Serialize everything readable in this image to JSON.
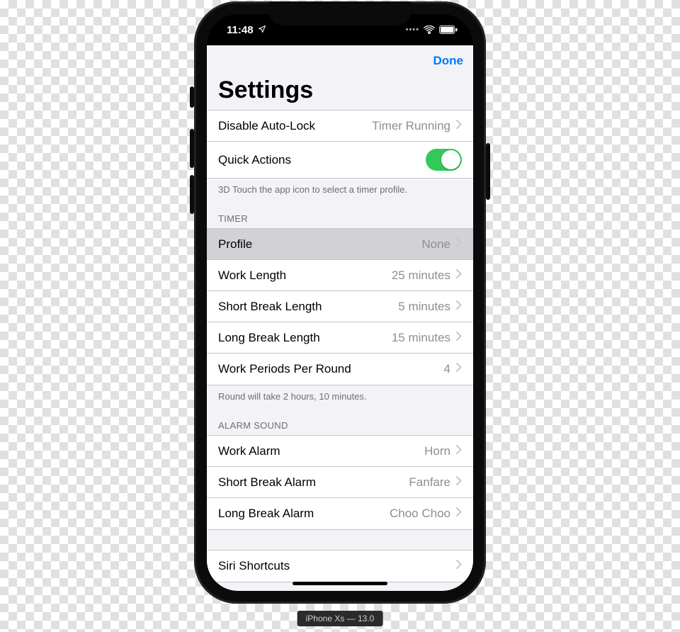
{
  "status": {
    "time": "11:48",
    "location_arrow": "➤"
  },
  "navbar": {
    "done": "Done"
  },
  "title": "Settings",
  "group1": {
    "items": [
      {
        "label": "Disable Auto-Lock",
        "value": "Timer Running"
      }
    ],
    "quick_actions": {
      "label": "Quick Actions",
      "on": true
    },
    "footer": "3D Touch the app icon to select a timer profile."
  },
  "timer": {
    "header": "TIMER",
    "items": [
      {
        "name": "profile",
        "label": "Profile",
        "value": "None",
        "selected": true
      },
      {
        "name": "work-length",
        "label": "Work Length",
        "value": "25 minutes"
      },
      {
        "name": "short-break-length",
        "label": "Short Break Length",
        "value": "5 minutes"
      },
      {
        "name": "long-break-length",
        "label": "Long Break Length",
        "value": "15 minutes"
      },
      {
        "name": "work-periods",
        "label": "Work Periods Per Round",
        "value": "4"
      }
    ],
    "footer": "Round will take 2 hours, 10 minutes."
  },
  "alarm": {
    "header": "ALARM SOUND",
    "items": [
      {
        "name": "work-alarm",
        "label": "Work Alarm",
        "value": "Horn"
      },
      {
        "name": "short-break-alarm",
        "label": "Short Break Alarm",
        "value": "Fanfare"
      },
      {
        "name": "long-break-alarm",
        "label": "Long Break Alarm",
        "value": "Choo Choo"
      }
    ]
  },
  "siri": {
    "items": [
      {
        "label": "Siri Shortcuts",
        "value": ""
      }
    ]
  },
  "caption": "iPhone Xs — 13.0"
}
